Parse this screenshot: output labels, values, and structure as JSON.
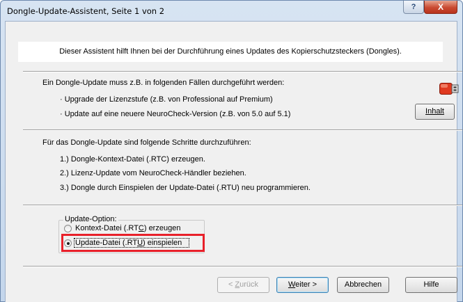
{
  "window": {
    "title": "Dongle-Update-Assistent, Seite 1 von 2",
    "help_glyph": "?",
    "close_glyph": "X"
  },
  "banner": {
    "text": "Dieser Assistent hilft Ihnen bei der Durchführung eines Updates des Kopierschutzsteckers (Dongles)."
  },
  "cases": {
    "heading": "Ein Dongle-Update muss z.B. in folgenden Fällen durchgeführt werden:",
    "items": [
      "· Upgrade der Lizenzstufe (z.B. von Professional auf Premium)",
      "· Update auf eine neuere NeuroCheck-Version (z.B. von 5.0 auf 5.1)"
    ],
    "inhalt_label": "Inhalt",
    "dongle_icon": "usb-dongle-icon",
    "dongle_color": "#e03a20"
  },
  "steps": {
    "heading": "Für das Dongle-Update sind folgende Schritte durchzuführen:",
    "items": [
      "1.) Dongle-Kontext-Datei (.RTC) erzeugen.",
      "2.) Lizenz-Update vom NeuroCheck-Händler beziehen.",
      "3.) Dongle durch Einspielen der Update-Datei (.RTU) neu programmieren."
    ]
  },
  "update_option": {
    "legend": "Update-Option:",
    "options": [
      {
        "label_pre": "Kontext-Datei (.RT",
        "label_u": "C",
        "label_post": ") erzeugen",
        "selected": false
      },
      {
        "label_pre": "Update-Datei (.RT",
        "label_u": "U",
        "label_post": ") einspielen",
        "selected": true
      }
    ],
    "highlight_color": "#e8202a"
  },
  "footer": {
    "back_pre": "< ",
    "back_u": "Z",
    "back_post": "urück",
    "next_u": "W",
    "next_post": "eiter >",
    "cancel": "Abbrechen",
    "help": "Hilfe"
  }
}
